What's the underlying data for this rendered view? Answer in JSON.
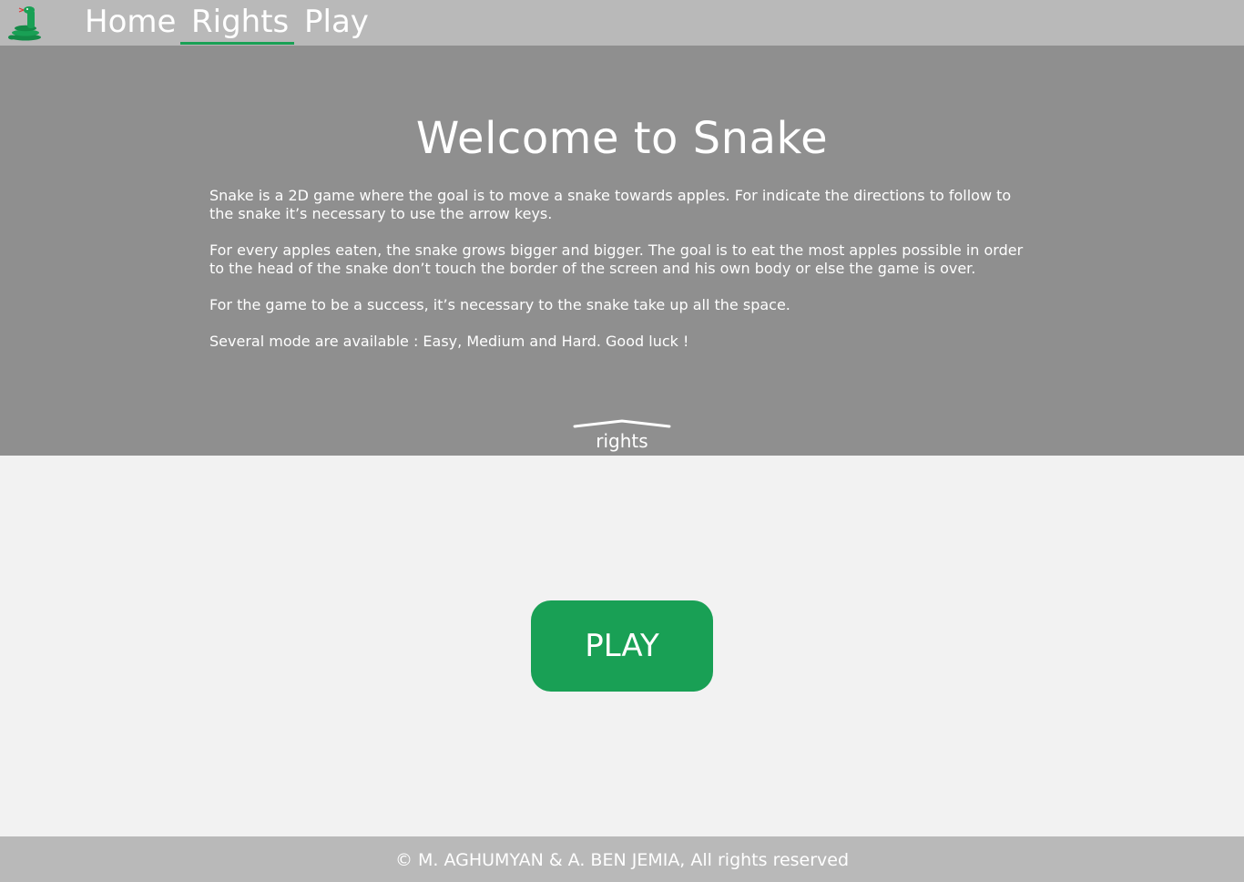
{
  "nav": {
    "logo_icon": "snake-logo-icon",
    "links": [
      {
        "label": "Home"
      },
      {
        "label": "Rights"
      },
      {
        "label": "Play"
      }
    ],
    "active": "Rights"
  },
  "hero": {
    "title": "Welcome to Snake",
    "paragraphs": [
      "Snake is a 2D game where the goal is to move a snake towards apples. For indicate the directions to follow to the snake it’s necessary to use the arrow keys.",
      "For every apples eaten, the snake grows bigger and bigger. The goal is to eat the most apples possible in order to the head of the snake don’t touch the border of the screen and his own body or else the game is over.",
      "For the game to be a success, it’s necessary to the snake take up all the space.",
      "Several mode are available : Easy, Medium and Hard. Good luck !"
    ],
    "rights_link": "rights"
  },
  "main": {
    "play_button": "PLAY"
  },
  "footer": {
    "text": "© M. AGHUMYAN & A. BEN JEMIA, All rights reserved"
  },
  "colors": {
    "nav_bg": "#b9b9b9",
    "hero_bg": "#8f8f8f",
    "page_bg": "#f2f2f2",
    "accent": "#19a055"
  }
}
